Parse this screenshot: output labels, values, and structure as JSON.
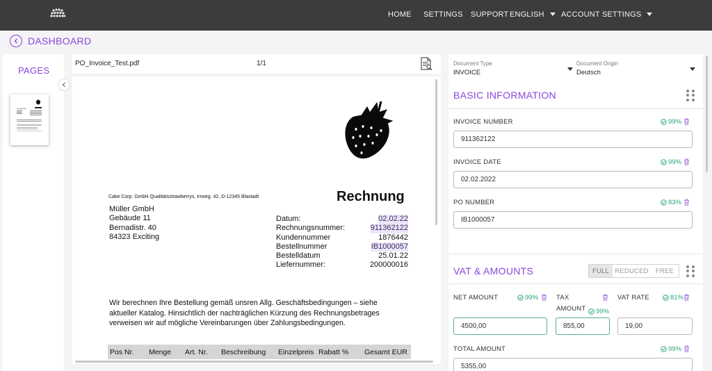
{
  "nav": {
    "logo": "logo-icon",
    "items": [
      "HOME",
      "SETTINGS",
      "SUPPORT"
    ],
    "language": "ENGLISH",
    "account": "ACCOUNT SETTINGS"
  },
  "back": {
    "label": "DASHBOARD"
  },
  "pages": {
    "title": "PAGES"
  },
  "viewer": {
    "file_name": "PO_Invoice_Test.pdf",
    "page_count": "1/1"
  },
  "document": {
    "sender": "Cake Corp. GmbH Qualitätsstrawberrys, Irrweg. 42, D-12345 Blastadt",
    "title": "Rechnung",
    "recipient": [
      "Müller GmbH",
      "Gebäude 11",
      "Bernadistr. 40",
      "84323 Exciting"
    ],
    "meta": [
      {
        "label": "Datum:",
        "value": "02.02.22",
        "highlight": true
      },
      {
        "label": "Rechnungsnummer:",
        "value": "911362122",
        "highlight": true
      },
      {
        "label": "Kundennummer",
        "value": "1876442",
        "highlight": false
      },
      {
        "label": "Bestellnummer",
        "value": "IB1000057",
        "highlight": true
      },
      {
        "label": "Bestelldatum",
        "value": "25.01.22",
        "highlight": false
      },
      {
        "label": "Liefernummer:",
        "value": "200000016",
        "highlight": false
      }
    ],
    "body_lines": [
      "Wir berechnen Ihre Bestellung gemäß unsren Allg. Geschäftsbedingungen – siehe",
      "aktueller Katalog. Hinsichtlich der nachträglichen Kürzung des Rechnungsbetrages",
      "verweisen wir auf mögliche Vereinbarungen über Zahlungsbedingungen."
    ],
    "table_headers": [
      "Pos Nr.",
      "Menge",
      "Art. Nr.",
      "Beschreibung",
      "Einzelpreis",
      "Rabatt %",
      "Gesamt EUR"
    ]
  },
  "panel": {
    "doc_type": {
      "label": "Document Type",
      "value": "INVOICE"
    },
    "doc_origin": {
      "label": "Document Origin",
      "value": "Deutsch"
    },
    "basic": {
      "title": "BASIC INFORMATION",
      "fields": [
        {
          "label": "INVOICE NUMBER",
          "confidence": "99%",
          "value": "911362122"
        },
        {
          "label": "INVOICE DATE",
          "confidence": "99%",
          "value": "02.02.2022"
        },
        {
          "label": "PO NUMBER",
          "confidence": "83%",
          "value": "IB1000057"
        }
      ]
    },
    "vat": {
      "title": "VAT & AMOUNTS",
      "modes": [
        "FULL",
        "REDUCED",
        "FREE"
      ],
      "active_mode": "FULL",
      "net_amount": {
        "label": "NET AMOUNT",
        "confidence": "99%",
        "value": "4500,00"
      },
      "tax_amount": {
        "label_1": "TAX",
        "label_2": "AMOUNT",
        "confidence": "99%",
        "value": "855,00"
      },
      "vat_rate": {
        "label": "VAT RATE",
        "confidence": "81%",
        "value": "19,00"
      },
      "total_amount": {
        "label": "TOTAL AMOUNT",
        "confidence": "99%",
        "value": "5355,00"
      }
    }
  },
  "colors": {
    "accent": "#8a45d9",
    "confidence": "#27a37a",
    "nav_bg": "#3c3c3c"
  }
}
